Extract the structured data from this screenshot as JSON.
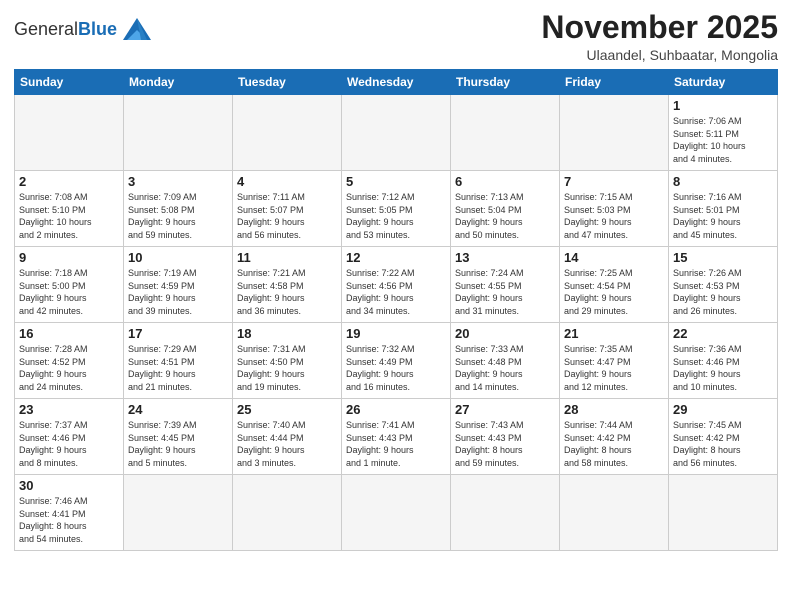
{
  "logo": {
    "text_general": "General",
    "text_blue": "Blue"
  },
  "header": {
    "month": "November 2025",
    "location": "Ulaandel, Suhbaatar, Mongolia"
  },
  "weekdays": [
    "Sunday",
    "Monday",
    "Tuesday",
    "Wednesday",
    "Thursday",
    "Friday",
    "Saturday"
  ],
  "weeks": [
    [
      {
        "day": "",
        "info": ""
      },
      {
        "day": "",
        "info": ""
      },
      {
        "day": "",
        "info": ""
      },
      {
        "day": "",
        "info": ""
      },
      {
        "day": "",
        "info": ""
      },
      {
        "day": "",
        "info": ""
      },
      {
        "day": "1",
        "info": "Sunrise: 7:06 AM\nSunset: 5:11 PM\nDaylight: 10 hours\nand 4 minutes."
      }
    ],
    [
      {
        "day": "2",
        "info": "Sunrise: 7:08 AM\nSunset: 5:10 PM\nDaylight: 10 hours\nand 2 minutes."
      },
      {
        "day": "3",
        "info": "Sunrise: 7:09 AM\nSunset: 5:08 PM\nDaylight: 9 hours\nand 59 minutes."
      },
      {
        "day": "4",
        "info": "Sunrise: 7:11 AM\nSunset: 5:07 PM\nDaylight: 9 hours\nand 56 minutes."
      },
      {
        "day": "5",
        "info": "Sunrise: 7:12 AM\nSunset: 5:05 PM\nDaylight: 9 hours\nand 53 minutes."
      },
      {
        "day": "6",
        "info": "Sunrise: 7:13 AM\nSunset: 5:04 PM\nDaylight: 9 hours\nand 50 minutes."
      },
      {
        "day": "7",
        "info": "Sunrise: 7:15 AM\nSunset: 5:03 PM\nDaylight: 9 hours\nand 47 minutes."
      },
      {
        "day": "8",
        "info": "Sunrise: 7:16 AM\nSunset: 5:01 PM\nDaylight: 9 hours\nand 45 minutes."
      }
    ],
    [
      {
        "day": "9",
        "info": "Sunrise: 7:18 AM\nSunset: 5:00 PM\nDaylight: 9 hours\nand 42 minutes."
      },
      {
        "day": "10",
        "info": "Sunrise: 7:19 AM\nSunset: 4:59 PM\nDaylight: 9 hours\nand 39 minutes."
      },
      {
        "day": "11",
        "info": "Sunrise: 7:21 AM\nSunset: 4:58 PM\nDaylight: 9 hours\nand 36 minutes."
      },
      {
        "day": "12",
        "info": "Sunrise: 7:22 AM\nSunset: 4:56 PM\nDaylight: 9 hours\nand 34 minutes."
      },
      {
        "day": "13",
        "info": "Sunrise: 7:24 AM\nSunset: 4:55 PM\nDaylight: 9 hours\nand 31 minutes."
      },
      {
        "day": "14",
        "info": "Sunrise: 7:25 AM\nSunset: 4:54 PM\nDaylight: 9 hours\nand 29 minutes."
      },
      {
        "day": "15",
        "info": "Sunrise: 7:26 AM\nSunset: 4:53 PM\nDaylight: 9 hours\nand 26 minutes."
      }
    ],
    [
      {
        "day": "16",
        "info": "Sunrise: 7:28 AM\nSunset: 4:52 PM\nDaylight: 9 hours\nand 24 minutes."
      },
      {
        "day": "17",
        "info": "Sunrise: 7:29 AM\nSunset: 4:51 PM\nDaylight: 9 hours\nand 21 minutes."
      },
      {
        "day": "18",
        "info": "Sunrise: 7:31 AM\nSunset: 4:50 PM\nDaylight: 9 hours\nand 19 minutes."
      },
      {
        "day": "19",
        "info": "Sunrise: 7:32 AM\nSunset: 4:49 PM\nDaylight: 9 hours\nand 16 minutes."
      },
      {
        "day": "20",
        "info": "Sunrise: 7:33 AM\nSunset: 4:48 PM\nDaylight: 9 hours\nand 14 minutes."
      },
      {
        "day": "21",
        "info": "Sunrise: 7:35 AM\nSunset: 4:47 PM\nDaylight: 9 hours\nand 12 minutes."
      },
      {
        "day": "22",
        "info": "Sunrise: 7:36 AM\nSunset: 4:46 PM\nDaylight: 9 hours\nand 10 minutes."
      }
    ],
    [
      {
        "day": "23",
        "info": "Sunrise: 7:37 AM\nSunset: 4:46 PM\nDaylight: 9 hours\nand 8 minutes."
      },
      {
        "day": "24",
        "info": "Sunrise: 7:39 AM\nSunset: 4:45 PM\nDaylight: 9 hours\nand 5 minutes."
      },
      {
        "day": "25",
        "info": "Sunrise: 7:40 AM\nSunset: 4:44 PM\nDaylight: 9 hours\nand 3 minutes."
      },
      {
        "day": "26",
        "info": "Sunrise: 7:41 AM\nSunset: 4:43 PM\nDaylight: 9 hours\nand 1 minute."
      },
      {
        "day": "27",
        "info": "Sunrise: 7:43 AM\nSunset: 4:43 PM\nDaylight: 8 hours\nand 59 minutes."
      },
      {
        "day": "28",
        "info": "Sunrise: 7:44 AM\nSunset: 4:42 PM\nDaylight: 8 hours\nand 58 minutes."
      },
      {
        "day": "29",
        "info": "Sunrise: 7:45 AM\nSunset: 4:42 PM\nDaylight: 8 hours\nand 56 minutes."
      }
    ],
    [
      {
        "day": "30",
        "info": "Sunrise: 7:46 AM\nSunset: 4:41 PM\nDaylight: 8 hours\nand 54 minutes."
      },
      {
        "day": "",
        "info": ""
      },
      {
        "day": "",
        "info": ""
      },
      {
        "day": "",
        "info": ""
      },
      {
        "day": "",
        "info": ""
      },
      {
        "day": "",
        "info": ""
      },
      {
        "day": "",
        "info": ""
      }
    ]
  ]
}
